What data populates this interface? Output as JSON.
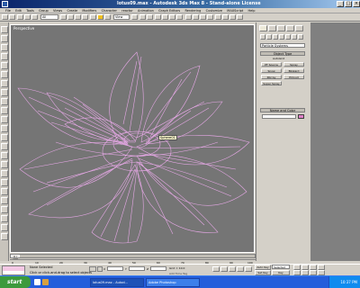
{
  "window": {
    "title": "lotus09.max - Autodesk 3ds Max 8 - Stand-alone License",
    "buttons": [
      "_",
      "□",
      "×"
    ]
  },
  "menubar": [
    "File",
    "Edit",
    "Tools",
    "Group",
    "Views",
    "Create",
    "Modifiers",
    "Character",
    "reactor",
    "Animation",
    "Graph Editors",
    "Rendering",
    "Customize",
    "MAXScript",
    "Help"
  ],
  "toolbar": {
    "selection_filter": "All",
    "view_select": "View"
  },
  "viewport": {
    "label": "Perspective",
    "pivot_tooltip": "Sphere01"
  },
  "command_panel": {
    "category_dropdown": "Particle Systems",
    "object_type_header": "Object Type",
    "autogrid": "AutoGrid",
    "buttons": [
      "PF Source",
      "Spray",
      "Snow",
      "Blizzard",
      "PArray",
      "PCloud",
      "Super Spray"
    ],
    "name_color_header": "Name and Color",
    "accent_color": "#e080c8"
  },
  "timeline": {
    "slider": "0 / 100",
    "ticks": [
      "0",
      "10",
      "20",
      "30",
      "40",
      "50",
      "60",
      "70",
      "80",
      "90",
      "100"
    ]
  },
  "status": {
    "selection": "None Selected",
    "prompt": "Click or click-and-drag to select objects",
    "x_label": "X",
    "y_label": "Y",
    "z_label": "Z",
    "x": "",
    "y": "",
    "z": "",
    "grid": "Grid = 10.0",
    "auto_key": "Auto Key",
    "selected": "Selected",
    "set_key": "Set Key",
    "key_filters": "Key Filters...",
    "add_time_tag": "Add Time Tag"
  },
  "taskbar": {
    "start_label": "start",
    "tasks": [
      "lotus09.max - Autod...",
      "Adobe Photoshop"
    ],
    "time": "10:37 PM"
  }
}
